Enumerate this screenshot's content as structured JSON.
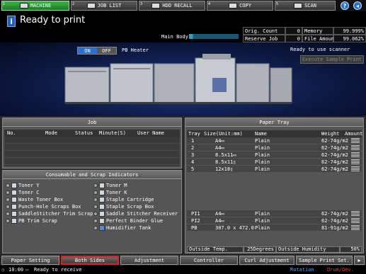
{
  "top_tabs": {
    "machine": "MACHINE",
    "job_list": "JOB LIST",
    "hdd_recall": "HDD RECALL",
    "copy": "COPY",
    "scan": "SCAN"
  },
  "status": {
    "message": "Ready to print",
    "main_body_label": "Main Body"
  },
  "counters": {
    "orig_count_label": "Orig. Count",
    "orig_count_value": "0",
    "memory_label": "Memory",
    "memory_value": "99.999%",
    "reserve_job_label": "Reserve Job",
    "reserve_job_value": "0",
    "file_amount_label": "File Amount",
    "file_amount_value": "99.062%"
  },
  "machine": {
    "on_label": "ON",
    "off_label": "OFF",
    "pb_heater": "PB Heater",
    "ready_scanner": "Ready to use scanner",
    "execute_sample": "Execute Sample Print"
  },
  "job_panel": {
    "title": "Job",
    "columns": [
      "No.",
      "Mode",
      "Status",
      "Minute(S)",
      "User Name"
    ]
  },
  "consumables": {
    "title": "Consumable and Scrap Indicators",
    "left": [
      "Toner Y",
      "Toner C",
      "Waste Toner Box",
      "Punch-Hole Scraps Box",
      "SaddleStitcher Trim Scrap",
      "PB Trim Scrap"
    ],
    "right": [
      "Toner M",
      "Toner K",
      "Staple Cartridge",
      "Staple Scrap Box",
      "Saddle Stitcher Receiver",
      "Perfect Binder Glue",
      "Humidifier Tank"
    ]
  },
  "paper_tray": {
    "title": "Paper Tray",
    "columns": [
      "Tray",
      "Size(Unit:mm)",
      "Name",
      "Weight",
      "Amount"
    ],
    "rows": [
      {
        "tray": "1",
        "size": "A4▭",
        "name": "Plain",
        "weight": "62-74g/m2"
      },
      {
        "tray": "2",
        "size": "A4▭",
        "name": "Plain",
        "weight": "62-74g/m2"
      },
      {
        "tray": "3",
        "size": "8.5x11▭",
        "name": "Plain",
        "weight": "62-74g/m2"
      },
      {
        "tray": "4",
        "size": "8.5x11▯",
        "name": "Plain",
        "weight": "62-74g/m2"
      },
      {
        "tray": "5",
        "size": "12x18▯",
        "name": "Plain",
        "weight": "62-74g/m2"
      }
    ],
    "pi_rows": [
      {
        "tray": "PI1",
        "size": "A4▭",
        "name": "Plain",
        "weight": "62-74g/m2"
      },
      {
        "tray": "PI2",
        "size": "A4▭",
        "name": "Plain",
        "weight": "62-74g/m2"
      },
      {
        "tray": "PB",
        "size": "307.0 x 472.0",
        "name": "Plain",
        "weight": "81-91g/m2"
      }
    ],
    "outside_temp_label": "Outside Temp.",
    "outside_temp_value": "25Degrees",
    "outside_humidity_label": "Outside Humidity",
    "outside_humidity_value": "50%"
  },
  "bottom_tabs": [
    "Paper Setting",
    "Both Sides",
    "Adjustment",
    "Controller",
    "Curl Adjustment",
    "Sample Print Set."
  ],
  "footer": {
    "time": "10:00",
    "message": "Ready to receive",
    "rotation": "Rotation",
    "drum": "Drum/Dev."
  },
  "colors": {
    "active_tab": "#2fa03a",
    "selected_outline": "#e02020",
    "accent_blue": "#2a6fd6"
  }
}
